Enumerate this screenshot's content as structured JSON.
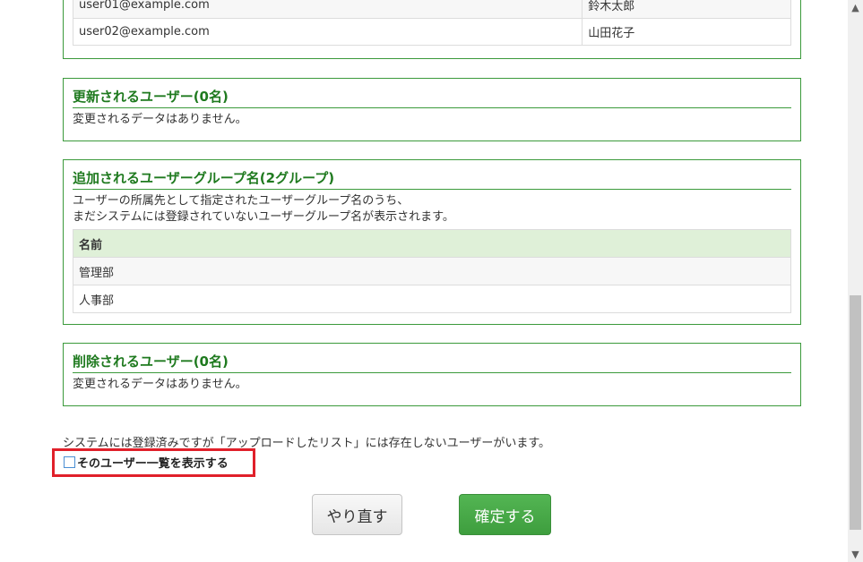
{
  "top_table": {
    "rows": [
      {
        "email": "user01@example.com",
        "name": "鈴木太郎"
      },
      {
        "email": "user02@example.com",
        "name": "山田花子"
      }
    ]
  },
  "updated_users": {
    "title": "更新されるユーザー(0名)",
    "message": "変更されるデータはありません。"
  },
  "added_groups": {
    "title": "追加されるユーザーグループ名(2グループ)",
    "description_line1": "ユーザーの所属先として指定されたユーザーグループ名のうち、",
    "description_line2": "まだシステムには登録されていないユーザーグループ名が表示されます。",
    "header": "名前",
    "rows": [
      "管理部",
      "人事部"
    ]
  },
  "deleted_users": {
    "title": "削除されるユーザー(0名)",
    "message": "変更されるデータはありません。"
  },
  "notice": "システムには登録済みですが「アップロードしたリスト」には存在しないユーザーがいます。",
  "show_list_checkbox": {
    "label": "そのユーザー一覧を表示する",
    "checked": false
  },
  "buttons": {
    "reset": "やり直す",
    "confirm": "確定する"
  },
  "colors": {
    "accent_green": "#1f7a1f",
    "highlight_red": "#e0202a",
    "confirm_button": "#4cae4c"
  },
  "icons": {
    "scroll_up": "▲",
    "scroll_down": "▼"
  }
}
